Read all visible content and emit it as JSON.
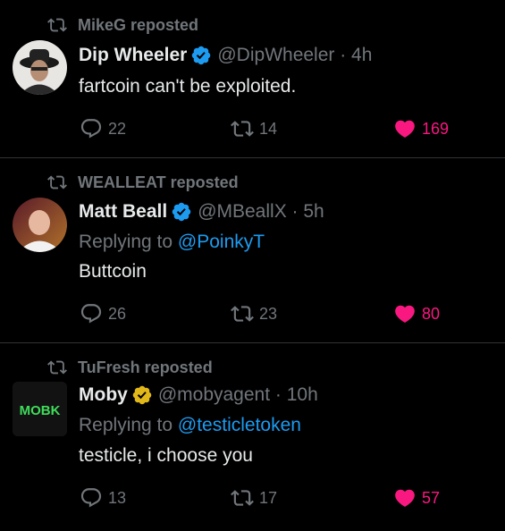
{
  "colors": {
    "background": "#000000",
    "text": "#e7e9ea",
    "muted": "#71767b",
    "link": "#1d9bf0",
    "like": "#f91880",
    "verified_blue": "#1d9bf0",
    "verified_gold": "#e2b719",
    "divider": "#2f3336"
  },
  "posts": [
    {
      "repost_label": "MikeG reposted",
      "name": "Dip Wheeler",
      "verified": "blue",
      "handle_time": "@DipWheeler · 4h",
      "text": "fartcoin can't be exploited.",
      "replies": "22",
      "reposts": "14",
      "likes": "169"
    },
    {
      "repost_label": "WEALLEAT reposted",
      "name": "Matt Beall",
      "verified": "blue",
      "handle_time": "@MBeallX · 5h",
      "replying_prefix": "Replying to ",
      "replying_to": "@PoinkyT",
      "text": "Buttcoin",
      "replies": "26",
      "reposts": "23",
      "likes": "80"
    },
    {
      "repost_label": "TuFresh reposted",
      "name": "Moby",
      "verified": "gold",
      "handle_time": "@mobyagent · 10h",
      "replying_prefix": "Replying to ",
      "replying_to": "@testicletoken",
      "avatar_text": "MOBK",
      "text": "testicle, i choose you",
      "replies": "13",
      "reposts": "17",
      "likes": "57"
    }
  ]
}
